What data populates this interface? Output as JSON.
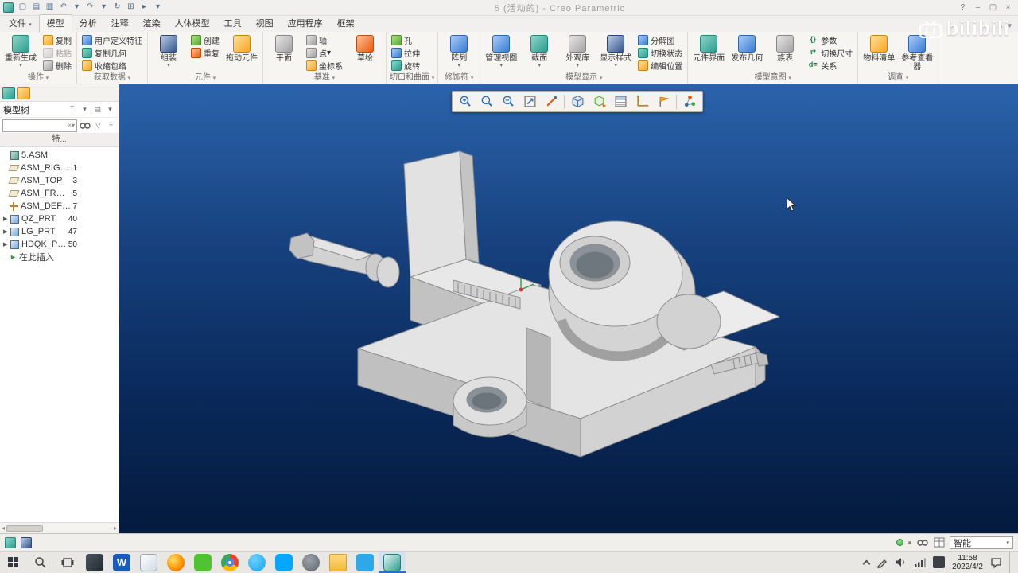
{
  "window": {
    "title": "5 (活动的) - Creo Parametric"
  },
  "icons": {
    "dropdown": "▾",
    "expand": "▶",
    "insert_arrow": "►",
    "left": "◂",
    "right": "▸",
    "clear": "×",
    "minimize": "–",
    "maximize": "▢",
    "close": "×",
    "chevron_up": "∧",
    "help": "?",
    "plus": "+",
    "undo": "↶",
    "redo": "↷",
    "regen": "↻",
    "new": "▢",
    "open": "▤",
    "save": "▥",
    "window": "⊞",
    "play": "▸",
    "sort": "T",
    "grid": "▤",
    "funnel": "▽"
  },
  "menu": {
    "file": "文件",
    "tabs": [
      "模型",
      "分析",
      "注释",
      "渲染",
      "人体模型",
      "工具",
      "视图",
      "应用程序",
      "框架"
    ]
  },
  "ribbon": {
    "groups": [
      {
        "label": "操作",
        "big": [
          "重新生成"
        ],
        "small": [
          "复制",
          "粘贴",
          "删除"
        ]
      },
      {
        "label": "获取数据",
        "small": [
          "用户定义特征",
          "复制几何",
          "收缩包络"
        ]
      },
      {
        "label": "元件",
        "big": [
          "组装",
          "拖动元件"
        ],
        "small": [
          "创建",
          "重复"
        ]
      },
      {
        "label": "基准",
        "big": [
          "平面",
          "草绘"
        ],
        "small": [
          "轴",
          "点",
          "坐标系"
        ]
      },
      {
        "label": "切口和曲面",
        "small": [
          "孔",
          "拉伸",
          "旋转"
        ]
      },
      {
        "label": "修饰符",
        "big": [
          "阵列"
        ]
      },
      {
        "label": "模型显示",
        "big": [
          "管理视图",
          "截面",
          "外观库",
          "显示样式"
        ],
        "small": [
          "分解图",
          "切换状态",
          "编辑位置"
        ]
      },
      {
        "label": "模型意图",
        "big": [
          "元件界面",
          "发布几何",
          "族表"
        ],
        "small": [
          "参数",
          "切换尺寸",
          "关系"
        ],
        "small_icons": [
          "{}",
          "⇄",
          "d="
        ]
      },
      {
        "label": "调查",
        "big": [
          "物料清单",
          "参考查看器"
        ]
      }
    ]
  },
  "navigator": {
    "tree_title": "模型树",
    "subheader": "特..."
  },
  "tree": {
    "items": [
      {
        "label": "5.ASM",
        "num": ""
      },
      {
        "label": "ASM_RIGHT",
        "num": "1"
      },
      {
        "label": "ASM_TOP",
        "num": "3"
      },
      {
        "label": "ASM_FRONT",
        "num": "5"
      },
      {
        "label": "ASM_DEF_CSYS",
        "num": "7"
      },
      {
        "label": "QZ_PRT",
        "num": "40"
      },
      {
        "label": "LG_PRT",
        "num": "47"
      },
      {
        "label": "HDQK_PRT",
        "num": "50"
      },
      {
        "label": "在此插入",
        "num": ""
      }
    ]
  },
  "viewport": {
    "toolbar": [
      "zoom-in",
      "zoom",
      "zoom-out",
      "refit",
      "repaint",
      "display-style",
      "saved-orientations",
      "view-manager",
      "datum-display-filter",
      "annotation-display",
      "spin-center"
    ]
  },
  "statusbar": {
    "filter_label": "智能"
  },
  "taskbar": {
    "time": "11:58",
    "date": "2022/4/2",
    "word_letter": "W"
  },
  "watermark": {
    "text": "bilibili"
  }
}
